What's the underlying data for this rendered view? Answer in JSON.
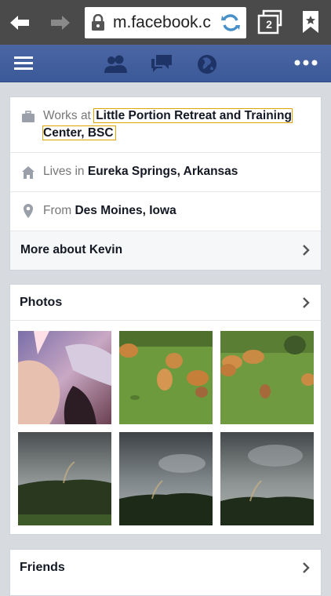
{
  "browser": {
    "url": "m.facebook.c",
    "tab_count": "2"
  },
  "about": {
    "work_prefix": "Works at",
    "work_place": "Little Portion Retreat and Training Center, BSC",
    "lives_prefix": "Lives in",
    "lives_place": "Eureka Springs, Arkansas",
    "from_prefix": "From",
    "from_place": "Des Moines, Iowa",
    "more_label": "More about Kevin"
  },
  "photos": {
    "title": "Photos",
    "items": [
      {
        "name": "photo-blurry-person"
      },
      {
        "name": "photo-chickens-1"
      },
      {
        "name": "photo-chickens-2"
      },
      {
        "name": "photo-rainbow-1"
      },
      {
        "name": "photo-rainbow-2"
      },
      {
        "name": "photo-rainbow-3"
      }
    ]
  },
  "friends": {
    "title": "Friends"
  },
  "colors": {
    "fb_blue": "#3b5998",
    "highlight": "#e0a500"
  }
}
